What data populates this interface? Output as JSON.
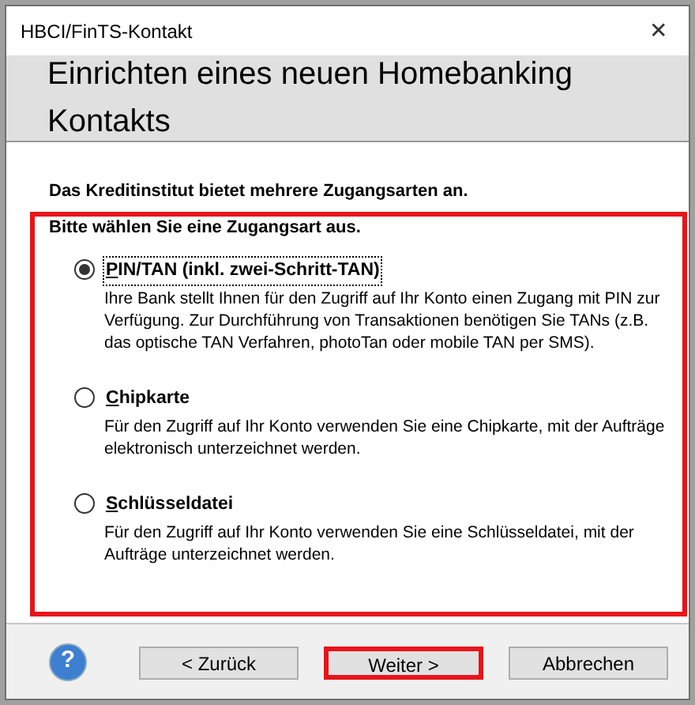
{
  "window": {
    "title": "HBCI/FinTS-Kontakt",
    "close": "✕"
  },
  "header": {
    "title": "Einrichten eines neuen Homebanking Kontakts"
  },
  "intro": "Das Kreditinstitut bietet mehrere Zugangsarten an.",
  "prompt": "Bitte wählen Sie eine Zugangsart aus.",
  "options": [
    {
      "label": "PIN/TAN (inkl. zwei-Schritt-TAN)",
      "selected": true,
      "description": "Ihre Bank stellt Ihnen für den Zugriff auf Ihr Konto einen Zugang mit PIN zur Verfügung. Zur Durchführung von Transaktionen benötigen Sie TANs (z.B. das optische TAN Verfahren, photoTan oder mobile TAN per SMS)."
    },
    {
      "label": "Chipkarte",
      "selected": false,
      "description": "Für den Zugriff auf Ihr Konto verwenden Sie eine Chipkarte, mit der Aufträge elektronisch unterzeichnet werden."
    },
    {
      "label": "Schlüsseldatei",
      "selected": false,
      "description": "Für den Zugriff auf Ihr Konto verwenden Sie eine Schlüsseldatei, mit der Aufträge unterzeichnet werden."
    }
  ],
  "footer": {
    "help": "?",
    "buttons": [
      {
        "label": "< Zurück",
        "highlighted": false
      },
      {
        "label": "Weiter >",
        "highlighted": true
      },
      {
        "label": "Abbrechen",
        "highlighted": false
      }
    ]
  }
}
